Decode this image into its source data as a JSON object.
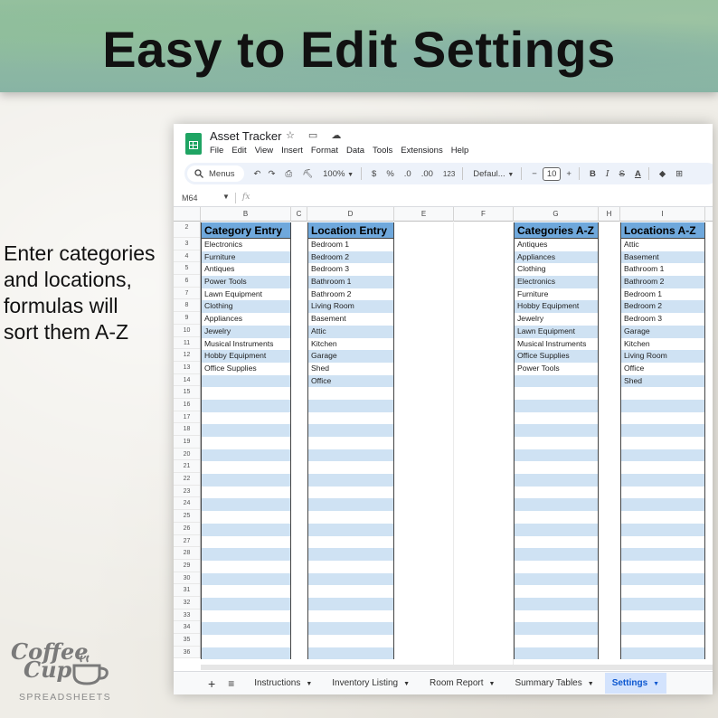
{
  "banner": {
    "title": "Easy to Edit Settings"
  },
  "side_text": {
    "line1": "Enter categories",
    "line2": "and locations,",
    "line3": "formulas will",
    "line4": "sort them A-Z"
  },
  "logo": {
    "word1": "Coffee",
    "word2": "Cup",
    "sub": "SPREADSHEETS"
  },
  "app": {
    "doc_title": "Asset Tracker",
    "title_icons": "☆ ▭ ☁",
    "menu": [
      "File",
      "Edit",
      "View",
      "Insert",
      "Format",
      "Data",
      "Tools",
      "Extensions",
      "Help"
    ]
  },
  "toolbar": {
    "search_label": "Menus",
    "zoom": "100%",
    "currency": "$",
    "percent": "%",
    "dec_less": ".0",
    "dec_more": ".00",
    "number_format": "123",
    "font": "Defaul...",
    "font_size": "10",
    "minus": "−",
    "plus": "+",
    "bold": "B",
    "italic": "I",
    "strike": "S",
    "text_color": "A"
  },
  "formula_bar": {
    "cell_ref": "M64",
    "fx": "fx"
  },
  "columns": [
    "B",
    "C",
    "D",
    "E",
    "F",
    "G",
    "H",
    "I"
  ],
  "row_numbers": [
    "2",
    "3",
    "4",
    "5",
    "6",
    "7",
    "8",
    "9",
    "10",
    "11",
    "12",
    "13",
    "14",
    "15",
    "16",
    "17",
    "18",
    "19",
    "20",
    "21",
    "22",
    "23",
    "24",
    "25",
    "26",
    "27",
    "28",
    "29",
    "30",
    "31",
    "32",
    "33",
    "34",
    "35",
    "36"
  ],
  "tables": [
    {
      "header": "Category Entry",
      "items": [
        "Electronics",
        "Furniture",
        "Antiques",
        "Power Tools",
        "Lawn Equipment",
        "Clothing",
        "Appliances",
        "Jewelry",
        "Musical Instruments",
        "Hobby Equipment",
        "Office Supplies"
      ]
    },
    {
      "header": "Location Entry",
      "items": [
        "Bedroom 1",
        "Bedroom 2",
        "Bedroom 3",
        "Bathroom 1",
        "Bathroom 2",
        "Living Room",
        "Basement",
        "Attic",
        "Kitchen",
        "Garage",
        "Shed",
        "Office"
      ]
    },
    {
      "header": "Categories A-Z",
      "items": [
        "Antiques",
        "Appliances",
        "Clothing",
        "Electronics",
        "Furniture",
        "Hobby Equipment",
        "Jewelry",
        "Lawn Equipment",
        "Musical Instruments",
        "Office Supplies",
        "Power Tools"
      ]
    },
    {
      "header": "Locations A-Z",
      "items": [
        "Attic",
        "Basement",
        "Bathroom 1",
        "Bathroom 2",
        "Bedroom 1",
        "Bedroom 2",
        "Bedroom 3",
        "Garage",
        "Kitchen",
        "Living Room",
        "Office",
        "Shed"
      ]
    }
  ],
  "sheet_tabs": [
    {
      "label": "Instructions",
      "active": false
    },
    {
      "label": "Inventory Listing",
      "active": false
    },
    {
      "label": "Room Report",
      "active": false
    },
    {
      "label": "Summary Tables",
      "active": false
    },
    {
      "label": "Settings",
      "active": true
    }
  ],
  "colors": {
    "header_blue": "#6fa8dc",
    "band_blue": "#cfe2f3",
    "sheets_green": "#1fa463",
    "active_tab": "#d3e3fd"
  }
}
